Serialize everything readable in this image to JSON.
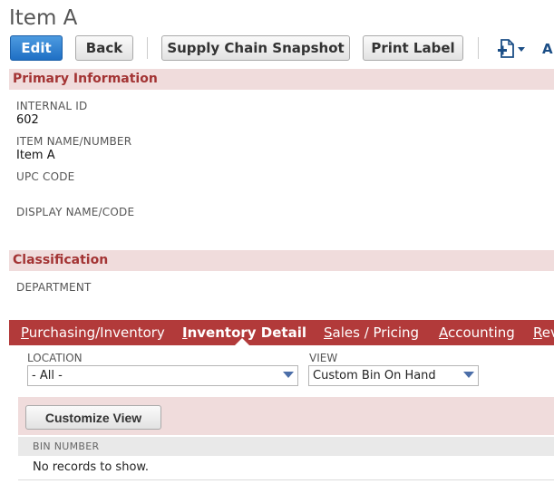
{
  "page": {
    "title": "Item A"
  },
  "toolbar": {
    "edit_label": "Edit",
    "back_label": "Back",
    "snapshot_label": "Supply Chain Snapshot",
    "print_label": "Print Label",
    "new_record_icon": "new-document-icon",
    "truncated_label": "A"
  },
  "primary_info": {
    "header": "Primary Information",
    "fields": [
      {
        "label": "INTERNAL ID",
        "value": "602"
      },
      {
        "label": "ITEM NAME/NUMBER",
        "value": "Item A"
      },
      {
        "label": "UPC CODE",
        "value": ""
      },
      {
        "label": "DISPLAY NAME/CODE",
        "value": ""
      }
    ]
  },
  "classification": {
    "header": "Classification",
    "fields": [
      {
        "label": "DEPARTMENT",
        "value": ""
      }
    ]
  },
  "tabs": [
    {
      "label": "Purchasing/Inventory",
      "access_key": "P",
      "rest": "urchasing/Inventory",
      "active": false
    },
    {
      "label": "Inventory Detail",
      "access_key": "I",
      "rest": "nventory Detail",
      "active": true
    },
    {
      "label": "Sales / Pricing",
      "access_key": "S",
      "rest": "ales / Pricing",
      "active": false
    },
    {
      "label": "Accounting",
      "access_key": "A",
      "rest": "ccounting",
      "active": false
    },
    {
      "label": "Rev",
      "access_key": "R",
      "rest": "ev",
      "active": false
    }
  ],
  "inventory_detail": {
    "location_label": "LOCATION",
    "location_value": "- All -",
    "view_label": "VIEW",
    "view_value": "Custom Bin On Hand",
    "customize_label": "Customize View",
    "table": {
      "columns": [
        "BIN NUMBER"
      ],
      "empty_message": "No records to show."
    }
  },
  "colors": {
    "section_header_bg": "#f0dcdc",
    "section_header_text": "#a33434",
    "tab_bar_bg": "#b23a3a",
    "primary_button": "#1f6fc4",
    "icon_blue": "#1b4e86"
  }
}
